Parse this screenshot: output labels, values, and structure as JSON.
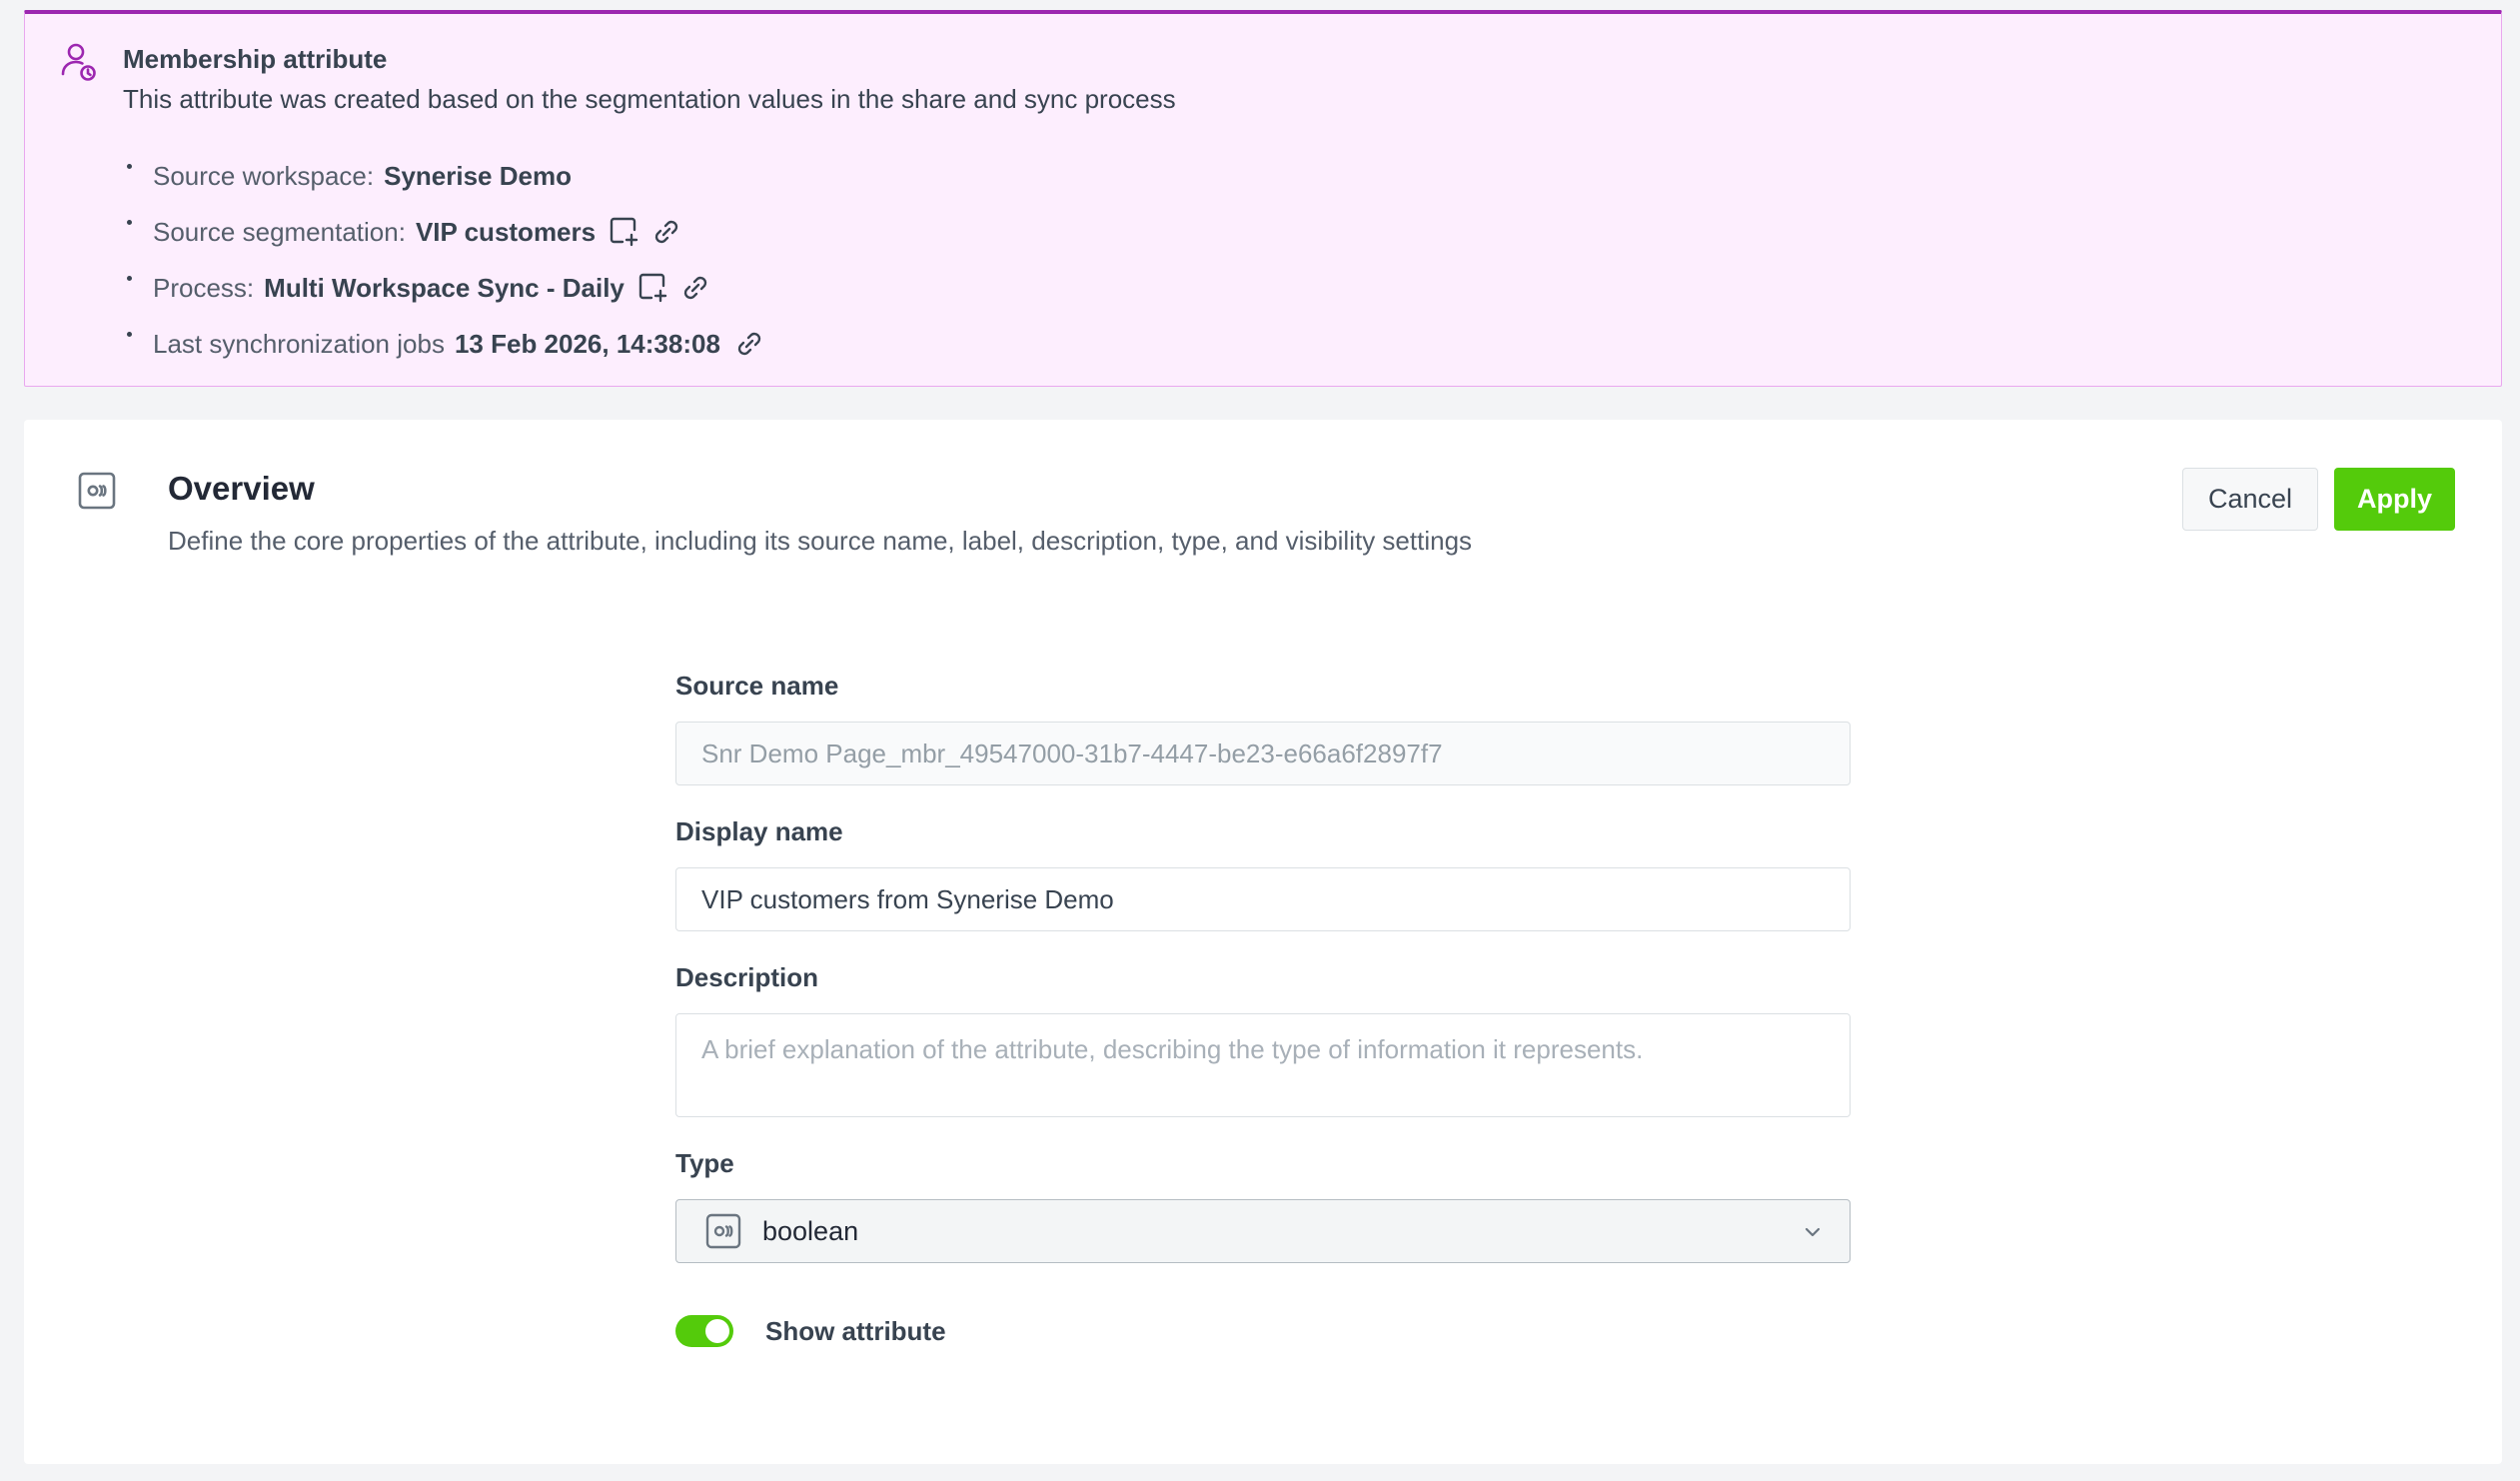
{
  "banner": {
    "icon": "user-sync-icon",
    "title": "Membership attribute",
    "description": "This attribute was created based on the segmentation values in the share and sync process",
    "items": [
      {
        "label": "Source workspace:",
        "value": "Synerise Demo"
      },
      {
        "label": "Source segmentation:",
        "value": "VIP customers"
      },
      {
        "label": "Process:",
        "value": "Multi Workspace Sync - Daily"
      },
      {
        "label": "Last synchronization jobs",
        "value": "13 Feb 2026, 14:38:08"
      }
    ],
    "accent_color": "#9c27b0",
    "background_color": "#fdeefe"
  },
  "overview": {
    "icon": "attribute-type-icon",
    "title": "Overview",
    "description": "Define the core properties of the attribute, including its source name, label, description, type, and visibility settings",
    "cancel_label": "Cancel",
    "apply_label": "Apply",
    "apply_color": "#54cb0b"
  },
  "form": {
    "source_name": {
      "label": "Source name",
      "value": "Snr Demo Page_mbr_49547000-31b7-4447-be23-e66a6f2897f7"
    },
    "display_name": {
      "label": "Display name",
      "value": "VIP customers from Synerise Demo"
    },
    "description": {
      "label": "Description",
      "placeholder": "A brief explanation of the attribute, describing the type of information it represents."
    },
    "type": {
      "label": "Type",
      "value": "boolean"
    },
    "show_attribute": {
      "label": "Show attribute",
      "enabled": true
    }
  }
}
